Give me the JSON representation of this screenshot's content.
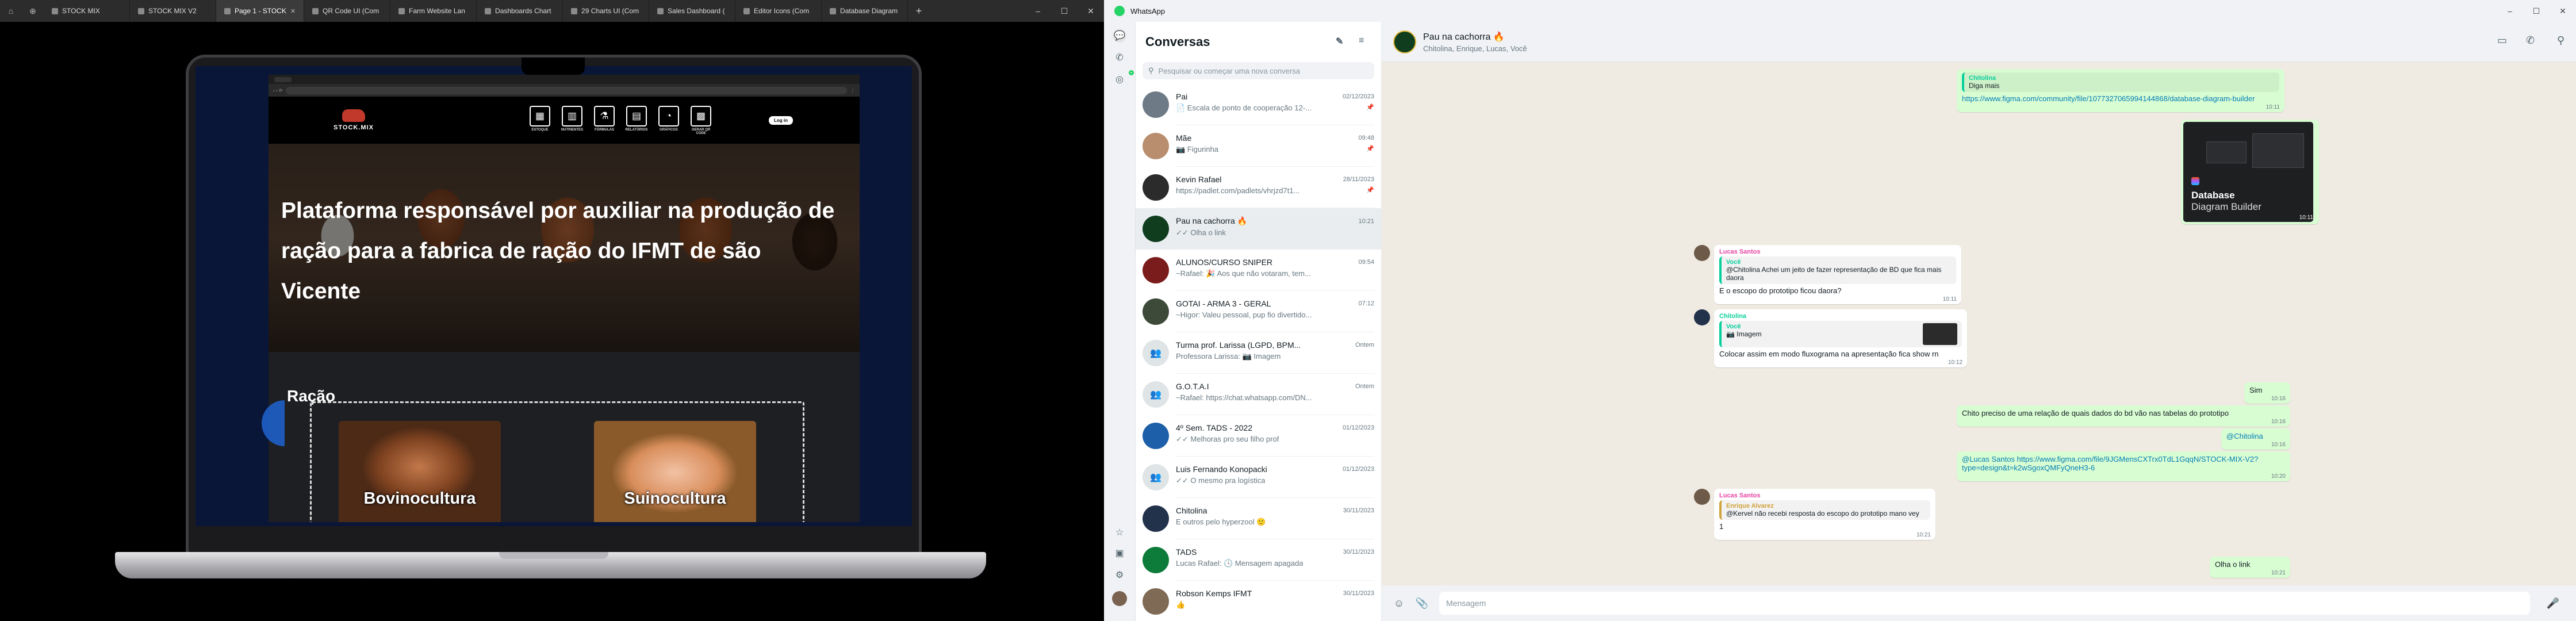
{
  "figma": {
    "tabs": [
      {
        "label": "STOCK MIX",
        "active": false
      },
      {
        "label": "STOCK MIX V2",
        "active": false
      },
      {
        "label": "Page 1 - STOCK",
        "active": true
      },
      {
        "label": "QR Code UI (Com",
        "active": false
      },
      {
        "label": "Farm Website Lan",
        "active": false
      },
      {
        "label": "Dashboards Chart",
        "active": false
      },
      {
        "label": "29 Charts UI (Com",
        "active": false
      },
      {
        "label": "Sales Dashboard (",
        "active": false
      },
      {
        "label": "Editor Icons (Com",
        "active": false
      },
      {
        "label": "Database Diagram",
        "active": false
      }
    ],
    "site": {
      "brand": "STOCK.MIX",
      "nav": [
        {
          "label": "ESTOQUE",
          "icon": "▦"
        },
        {
          "label": "NUTRIENTES",
          "icon": "▥"
        },
        {
          "label": "FÓRMULAS",
          "icon": "⚗"
        },
        {
          "label": "RELATÓRIOS",
          "icon": "▤"
        },
        {
          "label": "GRÁFICOS",
          "icon": "◔"
        },
        {
          "label": "GERAR QR CODE",
          "icon": "▩"
        }
      ],
      "login": "Log in",
      "hero": "Plataforma responsável por auxiliar na produção de ração para a fabrica de ração do IFMT de são Vicente",
      "section": "Ração",
      "cards": [
        "Bovinocultura",
        "Suinocultura"
      ]
    }
  },
  "whatsapp": {
    "app_title": "WhatsApp",
    "list_title": "Conversas",
    "search_placeholder": "Pesquisar ou começar uma nova conversa",
    "chats": [
      {
        "name": "Pai",
        "time": "02/12/2023",
        "preview": "📄 Escala de ponto de cooperação 12-...",
        "pinned": true,
        "color": "#6e7a86",
        "selected": false
      },
      {
        "name": "Mãe",
        "time": "09:48",
        "preview": "📷 Figurinha",
        "pinned": true,
        "color": "#b88e6e",
        "selected": false
      },
      {
        "name": "Kevin Rafael",
        "time": "28/11/2023",
        "preview": "https://padlet.com/padlets/vhrjzd7t1...",
        "pinned": true,
        "color": "#2b2b2b",
        "selected": false
      },
      {
        "name": "Pau na cachorra 🔥",
        "time": "10:21",
        "preview": "✓✓ Olha o link",
        "pinned": false,
        "color": "#0f3d1e",
        "selected": true
      },
      {
        "name": "ALUNOS/CURSO SNIPER",
        "time": "09:54",
        "preview": "~Rafael: 🎉 Aos que não votaram, tem...",
        "pinned": false,
        "color": "#7b1c1c",
        "selected": false
      },
      {
        "name": "GOTAI - ARMA 3 - GERAL",
        "time": "07:12",
        "preview": "~Higor: Valeu pessoal, pup fio divertido...",
        "pinned": false,
        "color": "#3d4a3a",
        "selected": false
      },
      {
        "name": "Turma prof. Larissa (LGPD, BPM...",
        "time": "Ontem",
        "preview": "Professora Larissa: 📷 Imagem",
        "pinned": false,
        "color": "#dfe5e7",
        "selected": false
      },
      {
        "name": "G.O.T.A.I",
        "time": "Ontem",
        "preview": "~Rafael: https://chat.whatsapp.com/DN...",
        "pinned": false,
        "color": "#dfe5e7",
        "selected": false
      },
      {
        "name": "4º Sem. TADS - 2022",
        "time": "01/12/2023",
        "preview": "✓✓ Melhoras pro seu filho prof",
        "pinned": false,
        "color": "#1d5fa8",
        "selected": false
      },
      {
        "name": "Luis Fernando Konopacki",
        "time": "01/12/2023",
        "preview": "✓✓ O mesmo pra logística",
        "pinned": false,
        "color": "#dfe5e7",
        "selected": false
      },
      {
        "name": "Chitolina",
        "time": "30/11/2023",
        "preview": "E outros pelo hyperzool 🙂",
        "pinned": false,
        "color": "#22324a",
        "selected": false
      },
      {
        "name": "TADS",
        "time": "30/11/2023",
        "preview": "Lucas Rafael: 🕓 Mensagem apagada",
        "pinned": false,
        "color": "#0d7b3a",
        "selected": false
      },
      {
        "name": "Robson Kemps IFMT",
        "time": "30/11/2023",
        "preview": "👍",
        "pinned": false,
        "color": "#7e6a55",
        "selected": false
      }
    ],
    "conversation": {
      "name": "Pau na cachorra 🔥",
      "members": "Chitolina, Enrique, Lucas, Você",
      "input_placeholder": "Mensagem",
      "msgs": {
        "m1_sender": "Chitolina",
        "m1_quote": "Diga mais",
        "m1_text": "https://www.figma.com/community/file/1077327065994144868/database-diagram-builder",
        "m1_time": "10:11",
        "m2_img_title": "Database",
        "m2_img_sub": "Diagram Builder",
        "m2_time": "10:11",
        "m3_sender": "Lucas Santos",
        "m3_qa": "Você",
        "m3_qtext": "@Chitolina Achei um jeito de fazer representação de BD que fica mais daora",
        "m3_text": "E o  escopo do prototipo ficou daora?",
        "m3_time": "10:11",
        "m4_sender": "Chitolina",
        "m4_qa": "Você",
        "m4_qtext": "📷 Imagem",
        "m4_text": "Colocar assim em modo fluxograma na apresentação fica show rn",
        "m4_time": "10:12",
        "m5_text": "Sim",
        "m5_time": "10:16",
        "m6_text": "Chito preciso de uma relação de quais dados do bd vão nas tabelas do prototipo",
        "m6_time": "10:16",
        "m7_text": "@Chitolina",
        "m7_time": "10:16",
        "m8_text": "@Lucas Santos https://www.figma.com/file/9JGMensCXTrx0TdL1GqqN/STOCK-MIX-V2?type=design&t=k2wSgoxQMFyQneH3-6",
        "m8_time": "10:20",
        "m9_sender": "Lucas Santos",
        "m9_qa": "Enrique Alvarez",
        "m9_qtext": "@Kervel não recebi resposta do escopo do prototipo mano vey",
        "m9_text": "1",
        "m9_time": "10:21",
        "m10_text": "Olha o link",
        "m10_time": "10:21"
      }
    }
  }
}
